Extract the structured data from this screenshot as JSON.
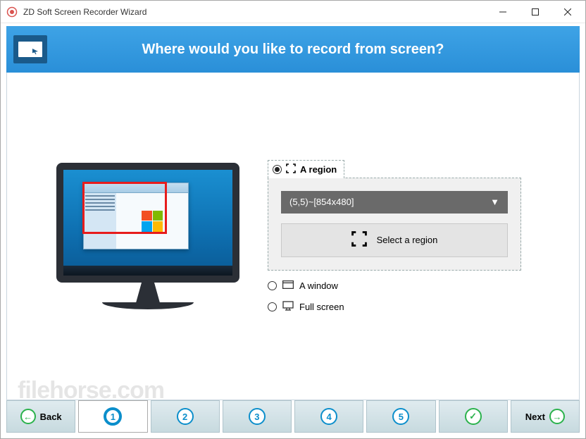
{
  "window": {
    "title": "ZD Soft Screen Recorder Wizard"
  },
  "header": {
    "question": "Where would you like to record from screen?"
  },
  "options": {
    "region": {
      "tab_label": "A region",
      "dropdown_value": "(5,5)~[854x480]",
      "dropdown_caret": "▼",
      "select_button": "Select a region"
    },
    "window_label": "A window",
    "fullscreen_label": "Full screen"
  },
  "footer": {
    "back": "Back",
    "next": "Next",
    "steps": {
      "s1": "1",
      "s2": "2",
      "s3": "3",
      "s4": "4",
      "s5": "5",
      "check": "✓"
    },
    "back_arrow": "←",
    "next_arrow": "→"
  },
  "watermark": "filehorse.com"
}
